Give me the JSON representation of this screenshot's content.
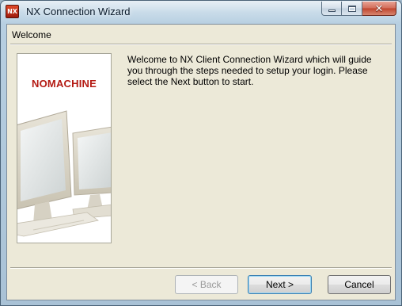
{
  "window": {
    "title": "NX Connection Wizard",
    "app_icon": "nx-icon",
    "controls": {
      "minimize": "minimize-icon",
      "maximize": "maximize-icon",
      "close": "close-icon"
    }
  },
  "page": {
    "title": "Welcome",
    "logo_text": "NOMACHINE",
    "welcome_text": "Welcome to NX Client Connection Wizard which will guide you through the steps needed to setup your login. Please select the Next button to start."
  },
  "buttons": {
    "back": "< Back",
    "next": "Next >",
    "cancel": "Cancel"
  },
  "colors": {
    "logo_red": "#b41a13",
    "dialog_bg": "#ece9d8"
  }
}
